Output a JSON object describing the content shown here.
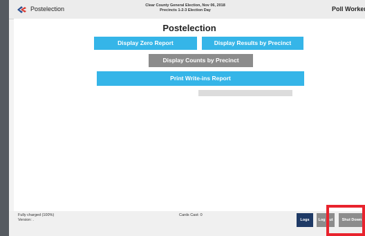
{
  "header": {
    "screen_name": "Postelection",
    "election_line1": "Clear County General Election, Nov 06, 2018",
    "election_line2": "Precincts 1-2-3 Election Day",
    "user_label": "Poll Worker",
    "logo_icon": "ballot-check-logo-icon"
  },
  "main": {
    "title": "Postelection",
    "buttons": {
      "zero_report": "Display Zero Report",
      "results_by_precinct": "Display Results by Precinct",
      "counts_by_precinct": "Display Counts by Precinct",
      "print_writeins": "Print Write-ins Report"
    },
    "progress_value": 0
  },
  "footer": {
    "battery_status": "Fully charged (100%)",
    "version": "Version: .",
    "cards_cast": "Cards Cast: 0",
    "logs_label": "Logs",
    "logout_label": "Log Out",
    "shutdown_label": "Shut Down"
  },
  "colors": {
    "accent_blue": "#35b5e8",
    "button_gray": "#8c8c8c",
    "logs_navy": "#1f3a66",
    "highlight_red": "#e8232d"
  }
}
